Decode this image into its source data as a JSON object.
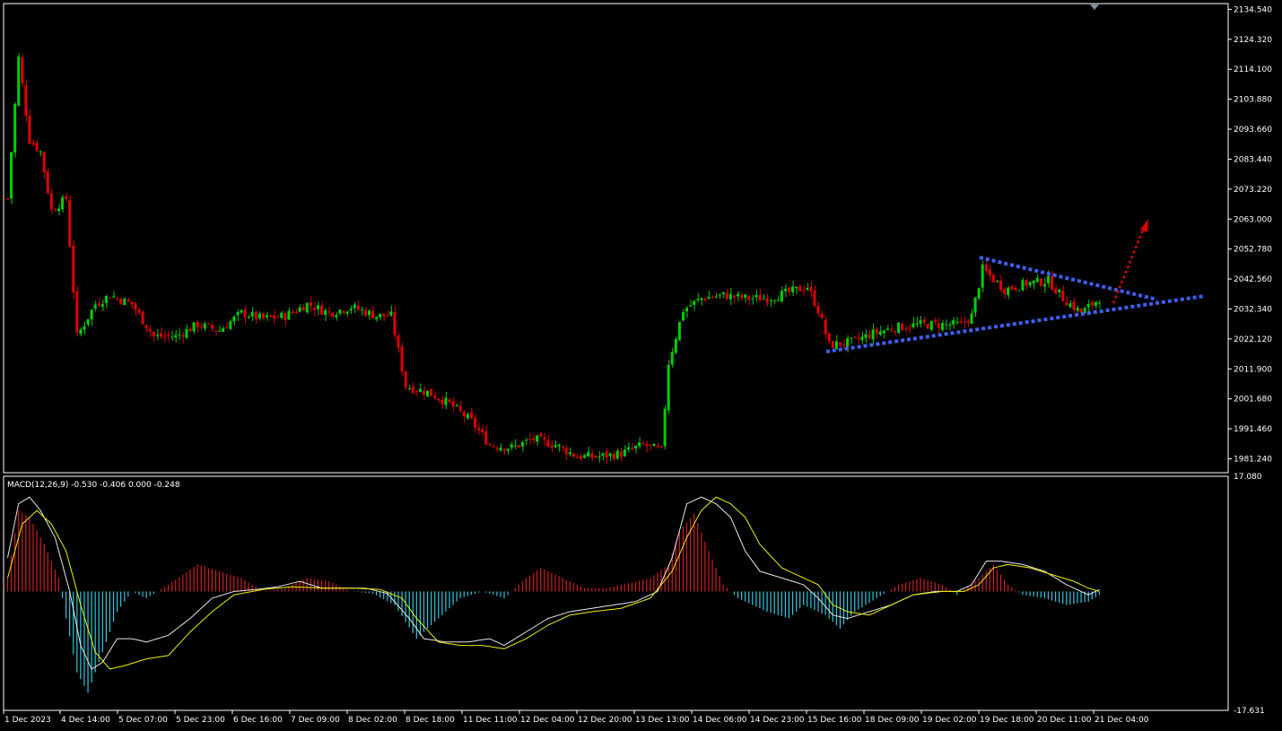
{
  "colors": {
    "background": "#000000",
    "frame": "#ffffff",
    "bull_candle": "#00d000",
    "bear_candle": "#e00000",
    "trendline": "#3f5ff0",
    "projection": "#e00000",
    "macd_hist_up": "#d02020",
    "macd_hist_down": "#30c8e0",
    "macd_line": "#e8e8e8",
    "signal_line": "#f0f000"
  },
  "icons": {
    "scroll_marker": "triangle-down-icon"
  },
  "macd_header": "MACD(12,26,9) -0.530 -0.406 0.000 -0.248",
  "chart_data": [
    {
      "type": "candlestick",
      "symbol_timeframe": "",
      "price_axis_labels": [
        "2134.540",
        "2124.320",
        "2114.100",
        "2103.880",
        "2093.660",
        "2083.440",
        "2073.220",
        "2063.000",
        "2052.780",
        "2042.560",
        "2032.340",
        "2022.120",
        "2011.900",
        "2001.680",
        "1991.460",
        "1981.240"
      ],
      "ylim": [
        1976.5,
        2136.5
      ],
      "time_axis_labels": [
        "1 Dec 2023",
        "4 Dec 14:00",
        "5 Dec 07:00",
        "5 Dec 23:00",
        "6 Dec 16:00",
        "7 Dec 09:00",
        "8 Dec 02:00",
        "8 Dec 18:00",
        "11 Dec 11:00",
        "12 Dec 04:00",
        "12 Dec 20:00",
        "13 Dec 13:00",
        "14 Dec 06:00",
        "14 Dec 23:00",
        "15 Dec 16:00",
        "18 Dec 09:00",
        "19 Dec 02:00",
        "19 Dec 18:00",
        "20 Dec 11:00",
        "21 Dec 04:00"
      ],
      "bar_count": 300,
      "close_path": [
        {
          "bar": 0,
          "price": 2070
        },
        {
          "bar": 3,
          "price": 2118
        },
        {
          "bar": 6,
          "price": 2090
        },
        {
          "bar": 9,
          "price": 2086
        },
        {
          "bar": 12,
          "price": 2066
        },
        {
          "bar": 16,
          "price": 2070
        },
        {
          "bar": 19,
          "price": 2023
        },
        {
          "bar": 24,
          "price": 2034
        },
        {
          "bar": 28,
          "price": 2037
        },
        {
          "bar": 34,
          "price": 2034
        },
        {
          "bar": 40,
          "price": 2023
        },
        {
          "bar": 46,
          "price": 2023
        },
        {
          "bar": 52,
          "price": 2027
        },
        {
          "bar": 58,
          "price": 2025
        },
        {
          "bar": 64,
          "price": 2031
        },
        {
          "bar": 70,
          "price": 2029
        },
        {
          "bar": 76,
          "price": 2030
        },
        {
          "bar": 82,
          "price": 2034
        },
        {
          "bar": 88,
          "price": 2031
        },
        {
          "bar": 94,
          "price": 2033
        },
        {
          "bar": 101,
          "price": 2030
        },
        {
          "bar": 105,
          "price": 2030
        },
        {
          "bar": 109,
          "price": 2006
        },
        {
          "bar": 115,
          "price": 2004
        },
        {
          "bar": 121,
          "price": 2000
        },
        {
          "bar": 127,
          "price": 1994
        },
        {
          "bar": 132,
          "price": 1986
        },
        {
          "bar": 138,
          "price": 1985
        },
        {
          "bar": 144,
          "price": 1988
        },
        {
          "bar": 150,
          "price": 1986
        },
        {
          "bar": 156,
          "price": 1982
        },
        {
          "bar": 162,
          "price": 1982
        },
        {
          "bar": 168,
          "price": 1983
        },
        {
          "bar": 174,
          "price": 1986
        },
        {
          "bar": 179,
          "price": 1984
        },
        {
          "bar": 181,
          "price": 2014
        },
        {
          "bar": 185,
          "price": 2032
        },
        {
          "bar": 190,
          "price": 2036
        },
        {
          "bar": 196,
          "price": 2037
        },
        {
          "bar": 202,
          "price": 2036
        },
        {
          "bar": 208,
          "price": 2036
        },
        {
          "bar": 214,
          "price": 2038
        },
        {
          "bar": 219,
          "price": 2040
        },
        {
          "bar": 222,
          "price": 2032
        },
        {
          "bar": 225,
          "price": 2020
        },
        {
          "bar": 231,
          "price": 2021
        },
        {
          "bar": 237,
          "price": 2024
        },
        {
          "bar": 243,
          "price": 2026
        },
        {
          "bar": 249,
          "price": 2027
        },
        {
          "bar": 255,
          "price": 2027
        },
        {
          "bar": 261,
          "price": 2027
        },
        {
          "bar": 264,
          "price": 2030
        },
        {
          "bar": 267,
          "price": 2046
        },
        {
          "bar": 273,
          "price": 2039
        },
        {
          "bar": 279,
          "price": 2041
        },
        {
          "bar": 285,
          "price": 2042
        },
        {
          "bar": 289,
          "price": 2036
        },
        {
          "bar": 294,
          "price": 2031
        },
        {
          "bar": 299,
          "price": 2036
        }
      ],
      "annotations": [
        {
          "type": "trendline",
          "style": "dotted",
          "from": {
            "date": "15 Dec 16:00",
            "price": 2015
          },
          "to": {
            "date": "after 21 Dec 04:00",
            "price": 2035
          }
        },
        {
          "type": "trendline",
          "style": "dotted",
          "from": {
            "date": "19 Dec 18:00",
            "price": 2049
          },
          "to": {
            "date": "after 21 Dec 04:00",
            "price": 2034
          }
        },
        {
          "type": "projection-arrow",
          "style": "dotted",
          "from": {
            "date": "21 Dec 04:00",
            "price": 2031
          },
          "to": {
            "date": "after 21 Dec 04:00",
            "price": 2061
          }
        }
      ]
    },
    {
      "type": "macd",
      "params": "12,26,9",
      "values": {
        "main": -0.53,
        "signal": -0.406,
        "extra": 0.0,
        "histogram": -0.248
      },
      "axis_labels": [
        "17.080",
        "-17.631"
      ],
      "ylim": [
        -17.631,
        17.08
      ],
      "histogram": [
        {
          "bar": 0,
          "value": 2
        },
        {
          "bar": 3,
          "value": 12
        },
        {
          "bar": 6,
          "value": 11
        },
        {
          "bar": 10,
          "value": 7
        },
        {
          "bar": 14,
          "value": 2
        },
        {
          "bar": 16,
          "value": -4
        },
        {
          "bar": 19,
          "value": -12
        },
        {
          "bar": 22,
          "value": -15
        },
        {
          "bar": 26,
          "value": -9
        },
        {
          "bar": 30,
          "value": -3
        },
        {
          "bar": 34,
          "value": 0
        },
        {
          "bar": 38,
          "value": -1
        },
        {
          "bar": 44,
          "value": 1
        },
        {
          "bar": 52,
          "value": 4
        },
        {
          "bar": 58,
          "value": 3
        },
        {
          "bar": 64,
          "value": 2
        },
        {
          "bar": 70,
          "value": 0
        },
        {
          "bar": 76,
          "value": 0.5
        },
        {
          "bar": 82,
          "value": 2
        },
        {
          "bar": 88,
          "value": 1.5
        },
        {
          "bar": 94,
          "value": 0
        },
        {
          "bar": 100,
          "value": -0.3
        },
        {
          "bar": 106,
          "value": -2
        },
        {
          "bar": 112,
          "value": -7
        },
        {
          "bar": 118,
          "value": -4
        },
        {
          "bar": 124,
          "value": -1
        },
        {
          "bar": 130,
          "value": 0
        },
        {
          "bar": 136,
          "value": -1
        },
        {
          "bar": 142,
          "value": 2
        },
        {
          "bar": 146,
          "value": 3.5
        },
        {
          "bar": 152,
          "value": 2
        },
        {
          "bar": 158,
          "value": 0.5
        },
        {
          "bar": 164,
          "value": 0.5
        },
        {
          "bar": 170,
          "value": 1.2
        },
        {
          "bar": 176,
          "value": 2
        },
        {
          "bar": 181,
          "value": 4
        },
        {
          "bar": 184,
          "value": 9
        },
        {
          "bar": 188,
          "value": 11.5
        },
        {
          "bar": 192,
          "value": 6
        },
        {
          "bar": 196,
          "value": 1
        },
        {
          "bar": 200,
          "value": -1
        },
        {
          "bar": 208,
          "value": -3
        },
        {
          "bar": 214,
          "value": -4
        },
        {
          "bar": 218,
          "value": -2
        },
        {
          "bar": 224,
          "value": -3.5
        },
        {
          "bar": 228,
          "value": -5.5
        },
        {
          "bar": 232,
          "value": -3
        },
        {
          "bar": 238,
          "value": -1
        },
        {
          "bar": 244,
          "value": 1
        },
        {
          "bar": 250,
          "value": 2
        },
        {
          "bar": 256,
          "value": 1
        },
        {
          "bar": 260,
          "value": -0.5
        },
        {
          "bar": 266,
          "value": 2
        },
        {
          "bar": 270,
          "value": 4
        },
        {
          "bar": 274,
          "value": 1
        },
        {
          "bar": 278,
          "value": -0.5
        },
        {
          "bar": 284,
          "value": -1
        },
        {
          "bar": 290,
          "value": -2
        },
        {
          "bar": 296,
          "value": -1.5
        },
        {
          "bar": 299,
          "value": -0.5
        }
      ],
      "main_line": [
        {
          "bar": 0,
          "value": 5
        },
        {
          "bar": 3,
          "value": 13
        },
        {
          "bar": 6,
          "value": 14
        },
        {
          "bar": 9,
          "value": 12
        },
        {
          "bar": 13,
          "value": 8
        },
        {
          "bar": 17,
          "value": 0
        },
        {
          "bar": 20,
          "value": -8
        },
        {
          "bar": 23,
          "value": -11.5
        },
        {
          "bar": 26,
          "value": -10.5
        },
        {
          "bar": 30,
          "value": -7
        },
        {
          "bar": 34,
          "value": -7
        },
        {
          "bar": 38,
          "value": -7.5
        },
        {
          "bar": 44,
          "value": -6.5
        },
        {
          "bar": 50,
          "value": -4
        },
        {
          "bar": 56,
          "value": -1
        },
        {
          "bar": 62,
          "value": 0
        },
        {
          "bar": 68,
          "value": 0.3
        },
        {
          "bar": 74,
          "value": 0.7
        },
        {
          "bar": 80,
          "value": 1.5
        },
        {
          "bar": 86,
          "value": 0.5
        },
        {
          "bar": 92,
          "value": 0.5
        },
        {
          "bar": 98,
          "value": 0.5
        },
        {
          "bar": 104,
          "value": -0.3
        },
        {
          "bar": 110,
          "value": -4
        },
        {
          "bar": 114,
          "value": -7
        },
        {
          "bar": 120,
          "value": -7.5
        },
        {
          "bar": 126,
          "value": -7.5
        },
        {
          "bar": 132,
          "value": -7
        },
        {
          "bar": 136,
          "value": -8
        },
        {
          "bar": 142,
          "value": -6
        },
        {
          "bar": 148,
          "value": -4
        },
        {
          "bar": 154,
          "value": -3
        },
        {
          "bar": 160,
          "value": -2.5
        },
        {
          "bar": 166,
          "value": -2
        },
        {
          "bar": 172,
          "value": -1.5
        },
        {
          "bar": 178,
          "value": 0
        },
        {
          "bar": 182,
          "value": 5
        },
        {
          "bar": 186,
          "value": 13
        },
        {
          "bar": 190,
          "value": 14
        },
        {
          "bar": 194,
          "value": 13
        },
        {
          "bar": 198,
          "value": 11
        },
        {
          "bar": 202,
          "value": 6
        },
        {
          "bar": 206,
          "value": 3
        },
        {
          "bar": 212,
          "value": 2
        },
        {
          "bar": 218,
          "value": 1
        },
        {
          "bar": 222,
          "value": -1
        },
        {
          "bar": 226,
          "value": -3.5
        },
        {
          "bar": 230,
          "value": -4
        },
        {
          "bar": 236,
          "value": -3
        },
        {
          "bar": 242,
          "value": -2
        },
        {
          "bar": 248,
          "value": -0.5
        },
        {
          "bar": 254,
          "value": 0
        },
        {
          "bar": 260,
          "value": 0
        },
        {
          "bar": 264,
          "value": 1
        },
        {
          "bar": 268,
          "value": 4.5
        },
        {
          "bar": 272,
          "value": 4.5
        },
        {
          "bar": 278,
          "value": 4
        },
        {
          "bar": 284,
          "value": 3
        },
        {
          "bar": 290,
          "value": 1
        },
        {
          "bar": 296,
          "value": -0.5
        },
        {
          "bar": 299,
          "value": 0.3
        }
      ],
      "signal_line": [
        {
          "bar": 0,
          "value": 2
        },
        {
          "bar": 4,
          "value": 10
        },
        {
          "bar": 8,
          "value": 12
        },
        {
          "bar": 12,
          "value": 10
        },
        {
          "bar": 16,
          "value": 6
        },
        {
          "bar": 20,
          "value": -2
        },
        {
          "bar": 24,
          "value": -9
        },
        {
          "bar": 28,
          "value": -11.5
        },
        {
          "bar": 32,
          "value": -11
        },
        {
          "bar": 38,
          "value": -10
        },
        {
          "bar": 44,
          "value": -9.5
        },
        {
          "bar": 50,
          "value": -6
        },
        {
          "bar": 56,
          "value": -3
        },
        {
          "bar": 62,
          "value": -0.5
        },
        {
          "bar": 70,
          "value": 0.3
        },
        {
          "bar": 78,
          "value": 0.7
        },
        {
          "bar": 86,
          "value": 0.5
        },
        {
          "bar": 94,
          "value": 0.5
        },
        {
          "bar": 102,
          "value": 0.3
        },
        {
          "bar": 108,
          "value": -1
        },
        {
          "bar": 112,
          "value": -4
        },
        {
          "bar": 118,
          "value": -7.5
        },
        {
          "bar": 124,
          "value": -8
        },
        {
          "bar": 130,
          "value": -8
        },
        {
          "bar": 136,
          "value": -8.5
        },
        {
          "bar": 142,
          "value": -7
        },
        {
          "bar": 148,
          "value": -5
        },
        {
          "bar": 154,
          "value": -3.5
        },
        {
          "bar": 160,
          "value": -3
        },
        {
          "bar": 168,
          "value": -2.5
        },
        {
          "bar": 176,
          "value": -1
        },
        {
          "bar": 182,
          "value": 3
        },
        {
          "bar": 186,
          "value": 8
        },
        {
          "bar": 190,
          "value": 12
        },
        {
          "bar": 194,
          "value": 14
        },
        {
          "bar": 198,
          "value": 13
        },
        {
          "bar": 202,
          "value": 11
        },
        {
          "bar": 206,
          "value": 7
        },
        {
          "bar": 212,
          "value": 3.5
        },
        {
          "bar": 218,
          "value": 2
        },
        {
          "bar": 222,
          "value": 1
        },
        {
          "bar": 226,
          "value": -2
        },
        {
          "bar": 230,
          "value": -3
        },
        {
          "bar": 236,
          "value": -3.5
        },
        {
          "bar": 242,
          "value": -2
        },
        {
          "bar": 248,
          "value": -0.5
        },
        {
          "bar": 256,
          "value": 0
        },
        {
          "bar": 262,
          "value": 0
        },
        {
          "bar": 266,
          "value": 1
        },
        {
          "bar": 270,
          "value": 3.5
        },
        {
          "bar": 274,
          "value": 4
        },
        {
          "bar": 280,
          "value": 3.5
        },
        {
          "bar": 286,
          "value": 2.5
        },
        {
          "bar": 292,
          "value": 1.5
        },
        {
          "bar": 296,
          "value": 0.5
        },
        {
          "bar": 299,
          "value": 0
        }
      ]
    }
  ]
}
